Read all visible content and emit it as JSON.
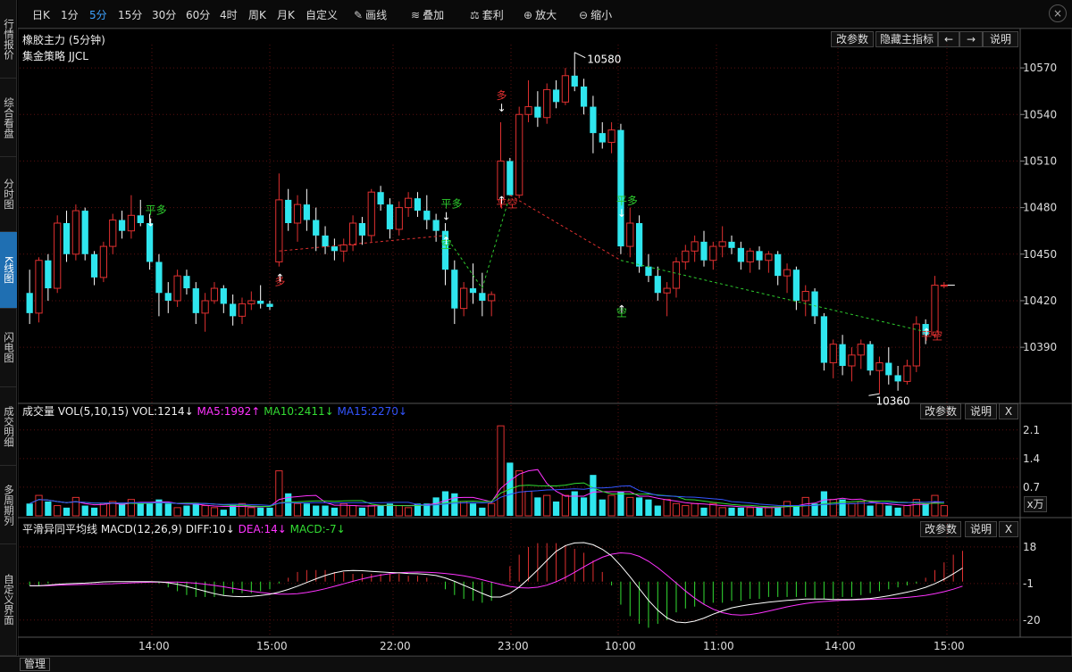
{
  "sidebar": {
    "tabs": [
      {
        "label": "行情报价",
        "active": false
      },
      {
        "label": "综合看盘",
        "active": false
      },
      {
        "label": "分时图",
        "active": false
      },
      {
        "label": "K线图",
        "active": true
      },
      {
        "label": "闪电图",
        "active": false
      },
      {
        "label": "成交明细",
        "active": false
      },
      {
        "label": "多周期列",
        "active": false
      },
      {
        "label": "自定义界面",
        "active": false
      }
    ]
  },
  "toolbar": {
    "periods": [
      "日K",
      "1分",
      "5分",
      "15分",
      "30分",
      "60分",
      "4时",
      "周K",
      "月K",
      "自定义"
    ],
    "active_period": "5分",
    "tools": [
      {
        "label": "画线",
        "icon": "pencil-icon",
        "glyph": "✎"
      },
      {
        "label": "叠加",
        "icon": "stack-icon",
        "glyph": "≋"
      },
      {
        "label": "套利",
        "icon": "arbitrage-icon",
        "glyph": "⚖"
      },
      {
        "label": "放大",
        "icon": "zoom-in-icon",
        "glyph": "⊕"
      },
      {
        "label": "缩小",
        "icon": "zoom-out-icon",
        "glyph": "⊖"
      }
    ],
    "close_glyph": "×"
  },
  "main_panel": {
    "title": "橡胶主力 (5分钟)",
    "strategy": "集金策略 JJCL",
    "buttons": [
      "改参数",
      "隐藏主指标",
      "←",
      "→",
      "说明"
    ],
    "price_ticks": [
      "10570",
      "10540",
      "10510",
      "10480",
      "10450",
      "10420",
      "10390"
    ],
    "high_label": "10580",
    "low_label": "10360"
  },
  "signals": [
    {
      "text": "平多",
      "color": "#2ecc2e"
    },
    {
      "text": "多",
      "color": "#e03030"
    },
    {
      "text": "平多",
      "color": "#2ecc2e"
    },
    {
      "text": "空",
      "color": "#2ecc2e"
    },
    {
      "text": "平空",
      "color": "#e03030"
    },
    {
      "text": "多",
      "color": "#e03030"
    },
    {
      "text": "平多",
      "color": "#2ecc2e"
    },
    {
      "text": "空",
      "color": "#2ecc2e"
    },
    {
      "text": "平空",
      "color": "#e03030"
    }
  ],
  "volume_panel": {
    "title": "成交量 VOL(5,10,15) VOL:1214↓",
    "ma5": "MA5:1992↑",
    "ma10": "MA10:2411↓",
    "ma15": "MA15:2270↓",
    "buttons": [
      "改参数",
      "说明",
      "X"
    ],
    "ticks": [
      "2.1",
      "1.4",
      "0.7"
    ],
    "unit": "x万"
  },
  "macd_panel": {
    "title": "平滑异同平均线 MACD(12,26,9) DIFF:10↓",
    "dea": "DEA:14↓",
    "macd": "MACD:-7↓",
    "buttons": [
      "改参数",
      "说明",
      "X"
    ],
    "ticks": [
      "18",
      "-1",
      "-20"
    ]
  },
  "time_axis": [
    "14:00",
    "15:00",
    "22:00",
    "23:00",
    "10:00",
    "11:00",
    "14:00",
    "15:00"
  ],
  "statusbar": {
    "manage": "管理"
  },
  "colors": {
    "up": "#e03030",
    "down": "#2fe6ee",
    "ma5": "#ff33ff",
    "ma10": "#33dd33",
    "ma15": "#3355ff",
    "grid": "#5a1010"
  },
  "chart_data": [
    {
      "type": "candlestick",
      "title": "橡胶主力 (5分钟)",
      "ylim": [
        10355,
        10585
      ],
      "candles": [
        [
          10425,
          10440,
          10405,
          10412
        ],
        [
          10412,
          10448,
          10406,
          10446
        ],
        [
          10446,
          10450,
          10420,
          10428
        ],
        [
          10428,
          10475,
          10425,
          10470
        ],
        [
          10470,
          10478,
          10445,
          10450
        ],
        [
          10450,
          10482,
          10446,
          10478
        ],
        [
          10478,
          10480,
          10446,
          10450
        ],
        [
          10450,
          10452,
          10430,
          10435
        ],
        [
          10435,
          10458,
          10432,
          10455
        ],
        [
          10455,
          10476,
          10450,
          10472
        ],
        [
          10472,
          10478,
          10460,
          10465
        ],
        [
          10465,
          10488,
          10460,
          10475
        ],
        [
          10475,
          10485,
          10468,
          10470
        ],
        [
          10470,
          10476,
          10440,
          10445
        ],
        [
          10445,
          10450,
          10410,
          10425
        ],
        [
          10425,
          10432,
          10412,
          10420
        ],
        [
          10420,
          10440,
          10416,
          10436
        ],
        [
          10436,
          10440,
          10424,
          10428
        ],
        [
          10428,
          10432,
          10405,
          10412
        ],
        [
          10412,
          10425,
          10400,
          10420
        ],
        [
          10420,
          10432,
          10418,
          10428
        ],
        [
          10428,
          10430,
          10412,
          10418
        ],
        [
          10418,
          10424,
          10404,
          10410
        ],
        [
          10410,
          10422,
          10405,
          10418
        ],
        [
          10418,
          10426,
          10414,
          10420
        ],
        [
          10420,
          10430,
          10415,
          10418
        ],
        [
          10418,
          10420,
          10414,
          10416
        ],
        [
          10445,
          10502,
          10442,
          10485
        ],
        [
          10485,
          10492,
          10465,
          10470
        ],
        [
          10470,
          10488,
          10458,
          10482
        ],
        [
          10482,
          10492,
          10465,
          10472
        ],
        [
          10472,
          10480,
          10452,
          10462
        ],
        [
          10462,
          10468,
          10450,
          10455
        ],
        [
          10455,
          10460,
          10446,
          10452
        ],
        [
          10452,
          10460,
          10445,
          10456
        ],
        [
          10456,
          10475,
          10452,
          10470
        ],
        [
          10470,
          10474,
          10456,
          10462
        ],
        [
          10462,
          10492,
          10458,
          10490
        ],
        [
          10490,
          10494,
          10478,
          10482
        ],
        [
          10482,
          10486,
          10460,
          10466
        ],
        [
          10466,
          10484,
          10462,
          10480
        ],
        [
          10480,
          10490,
          10474,
          10486
        ],
        [
          10486,
          10490,
          10474,
          10478
        ],
        [
          10478,
          10488,
          10466,
          10472
        ],
        [
          10472,
          10476,
          10458,
          10465
        ],
        [
          10465,
          10470,
          10430,
          10440
        ],
        [
          10440,
          10446,
          10405,
          10415
        ],
        [
          10415,
          10432,
          10410,
          10428
        ],
        [
          10428,
          10444,
          10418,
          10425
        ],
        [
          10425,
          10438,
          10410,
          10420
        ],
        [
          10420,
          10426,
          10410,
          10424
        ],
        [
          10485,
          10535,
          10480,
          10510
        ],
        [
          10510,
          10512,
          10488,
          10488
        ],
        [
          10488,
          10545,
          10486,
          10540
        ],
        [
          10540,
          10562,
          10535,
          10545
        ],
        [
          10545,
          10555,
          10532,
          10538
        ],
        [
          10538,
          10560,
          10534,
          10556
        ],
        [
          10556,
          10562,
          10544,
          10548
        ],
        [
          10548,
          10570,
          10546,
          10565
        ],
        [
          10565,
          10580,
          10555,
          10558
        ],
        [
          10558,
          10563,
          10540,
          10545
        ],
        [
          10545,
          10552,
          10515,
          10528
        ],
        [
          10528,
          10535,
          10518,
          10522
        ],
        [
          10522,
          10535,
          10515,
          10530
        ],
        [
          10530,
          10534,
          10450,
          10455
        ],
        [
          10455,
          10480,
          10448,
          10470
        ],
        [
          10470,
          10475,
          10438,
          10442
        ],
        [
          10442,
          10450,
          10432,
          10436
        ],
        [
          10436,
          10442,
          10420,
          10425
        ],
        [
          10425,
          10432,
          10410,
          10428
        ],
        [
          10428,
          10448,
          10422,
          10445
        ],
        [
          10445,
          10456,
          10440,
          10452
        ],
        [
          10452,
          10462,
          10445,
          10458
        ],
        [
          10458,
          10465,
          10442,
          10446
        ],
        [
          10446,
          10458,
          10440,
          10455
        ],
        [
          10455,
          10468,
          10448,
          10458
        ],
        [
          10458,
          10462,
          10450,
          10454
        ],
        [
          10454,
          10458,
          10440,
          10445
        ],
        [
          10445,
          10454,
          10438,
          10452
        ],
        [
          10452,
          10455,
          10440,
          10446
        ],
        [
          10446,
          10452,
          10438,
          10450
        ],
        [
          10450,
          10452,
          10430,
          10436
        ],
        [
          10436,
          10444,
          10425,
          10440
        ],
        [
          10440,
          10442,
          10414,
          10420
        ],
        [
          10420,
          10430,
          10410,
          10426
        ],
        [
          10426,
          10428,
          10405,
          10410
        ],
        [
          10410,
          10412,
          10375,
          10380
        ],
        [
          10380,
          10395,
          10370,
          10392
        ],
        [
          10392,
          10398,
          10372,
          10378
        ],
        [
          10378,
          10390,
          10368,
          10385
        ],
        [
          10385,
          10395,
          10376,
          10392
        ],
        [
          10392,
          10394,
          10372,
          10375
        ],
        [
          10375,
          10384,
          10360,
          10380
        ],
        [
          10380,
          10390,
          10366,
          10372
        ],
        [
          10372,
          10378,
          10362,
          10368
        ],
        [
          10368,
          10382,
          10366,
          10378
        ],
        [
          10378,
          10410,
          10374,
          10405
        ],
        [
          10405,
          10408,
          10392,
          10398
        ],
        [
          10398,
          10436,
          10396,
          10430
        ],
        [
          10430,
          10432,
          10428,
          10430
        ]
      ],
      "annotations": [
        "10580",
        "10360"
      ]
    },
    {
      "type": "bar",
      "title": "成交量 VOL(5,10,15)",
      "ylabel": "x万",
      "ylim": [
        0,
        2.4
      ],
      "values": [
        0.3,
        0.5,
        0.35,
        0.25,
        0.2,
        0.45,
        0.25,
        0.2,
        0.3,
        0.35,
        0.3,
        0.4,
        0.3,
        0.3,
        0.4,
        0.3,
        0.2,
        0.25,
        0.3,
        0.25,
        0.2,
        0.15,
        0.25,
        0.3,
        0.2,
        0.2,
        0.2,
        1.1,
        0.55,
        0.3,
        0.3,
        0.25,
        0.25,
        0.2,
        0.3,
        0.25,
        0.2,
        0.25,
        0.25,
        0.3,
        0.25,
        0.2,
        0.3,
        0.3,
        0.45,
        0.6,
        0.55,
        0.35,
        0.3,
        0.2,
        0.3,
        2.2,
        1.3,
        1.1,
        0.6,
        0.45,
        0.5,
        0.35,
        0.5,
        0.6,
        0.45,
        1.0,
        0.4,
        0.5,
        0.6,
        0.45,
        0.45,
        0.4,
        0.25,
        0.4,
        0.3,
        0.25,
        0.3,
        0.2,
        0.3,
        0.2,
        0.2,
        0.2,
        0.2,
        0.2,
        0.2,
        0.2,
        0.35,
        0.25,
        0.45,
        0.3,
        0.6,
        0.4,
        0.4,
        0.3,
        0.35,
        0.25,
        0.3,
        0.25,
        0.2,
        0.25,
        0.4,
        0.3,
        0.5,
        0.25
      ]
    },
    {
      "type": "bar",
      "title": "平滑异同平均线 MACD(12,26,9)",
      "ylim": [
        -28,
        24
      ],
      "values": [
        -2,
        -2,
        -1,
        0,
        0,
        0,
        0,
        0,
        0,
        0,
        0,
        0,
        0,
        0,
        -1,
        -3,
        -5,
        -7,
        -8,
        -8,
        -8,
        -7,
        -6,
        -6,
        -6,
        -5,
        -4,
        -1,
        2,
        5,
        6,
        6,
        6,
        5,
        5,
        4,
        4,
        4,
        4,
        4,
        4,
        3,
        3,
        2,
        0,
        -4,
        -7,
        -9,
        -10,
        -11,
        -10,
        0,
        8,
        14,
        18,
        20,
        20,
        20,
        19,
        17,
        15,
        11,
        5,
        -2,
        -12,
        -18,
        -22,
        -24,
        -22,
        -20,
        -16,
        -14,
        -13,
        -12,
        -11,
        -11,
        -10,
        -10,
        -9,
        -9,
        -8,
        -8,
        -8,
        -8,
        -8,
        -9,
        -9,
        -9,
        -8,
        -8,
        -7,
        -6,
        -5,
        -4,
        -3,
        -2,
        -1,
        2,
        6,
        10,
        14,
        16
      ]
    }
  ]
}
